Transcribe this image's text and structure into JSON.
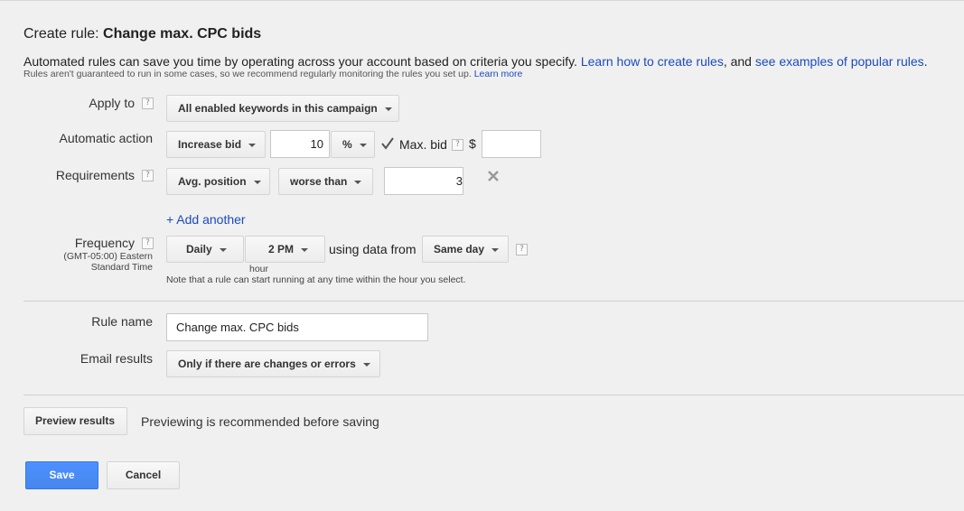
{
  "header": {
    "title_prefix": "Create rule: ",
    "title_name": "Change max. CPC bids",
    "desc_text": "Automated rules can save you time by operating across your account based on criteria you specify. ",
    "desc_link1": "Learn how to create rules",
    "desc_mid": ", and ",
    "desc_link2": "see examples of popular rules",
    "desc_end": ".",
    "note_text": "Rules aren't guaranteed to run in some cases, so we recommend regularly monitoring the rules you set up. ",
    "note_link": "Learn more"
  },
  "help_glyph": "?",
  "apply_to": {
    "label": "Apply to",
    "value": "All enabled keywords in this campaign"
  },
  "automatic_action": {
    "label": "Automatic action",
    "action": "Increase bid",
    "amount": "10",
    "unit": "%",
    "max_bid_checked": true,
    "max_bid_label": "Max. bid",
    "currency": "$",
    "max_bid_value": ""
  },
  "requirements": {
    "label": "Requirements",
    "metric": "Avg. position",
    "operator": "worse than",
    "value": "3",
    "add_another": "+ Add another"
  },
  "frequency": {
    "label": "Frequency",
    "tz_line1": "(GMT-05:00) Eastern",
    "tz_line2": "Standard Time",
    "period": "Daily",
    "hour": "2 PM",
    "hour_caption": "hour",
    "using_data_from": "using data from",
    "data_range": "Same day",
    "note": "Note that a rule can start running at any time within the hour you select."
  },
  "rule_name": {
    "label": "Rule name",
    "value": "Change max. CPC bids"
  },
  "email_results": {
    "label": "Email results",
    "value": "Only if there are changes or errors"
  },
  "preview": {
    "button": "Preview results",
    "text": "Previewing is recommended before saving"
  },
  "footer": {
    "save": "Save",
    "cancel": "Cancel"
  },
  "colors": {
    "link": "#1a4bbd",
    "primary": "#4d90fe",
    "background": "#f0f0f0"
  }
}
